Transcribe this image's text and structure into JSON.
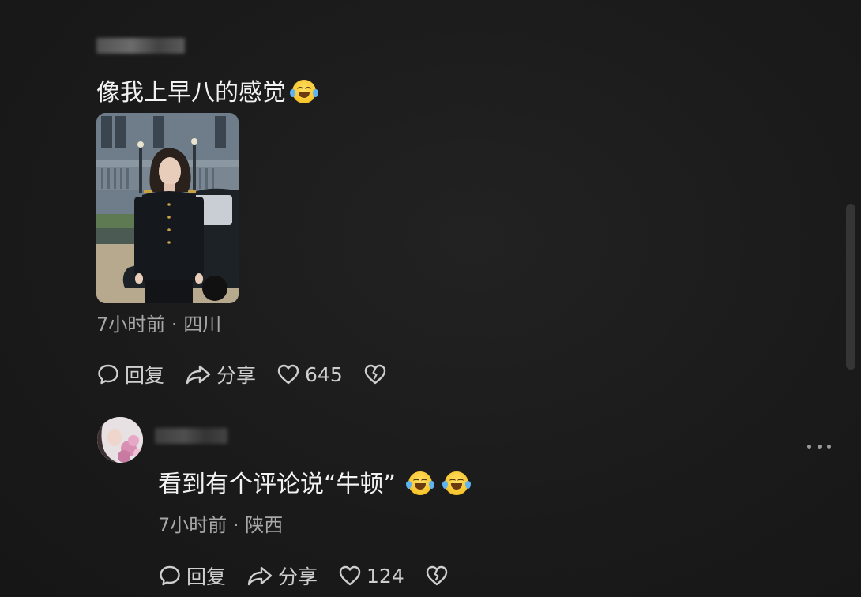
{
  "comments": [
    {
      "text": "像我上早八的感觉",
      "emoji": "laughing-crying-emoji",
      "time": "7小时前",
      "location": "四川",
      "reply_label": "回复",
      "share_label": "分享",
      "likes": "645"
    },
    {
      "text": "看到有个评论说“牛顿”",
      "emoji": "laughing-crying-emoji",
      "time": "7小时前",
      "location": "陕西",
      "reply_label": "回复",
      "share_label": "分享",
      "likes": "124"
    }
  ],
  "separator": "·",
  "colors": {
    "background": "#1b1b1b",
    "text": "#f2f2f2",
    "meta": "#a8a8a8",
    "emoji": "#f7c42c"
  }
}
